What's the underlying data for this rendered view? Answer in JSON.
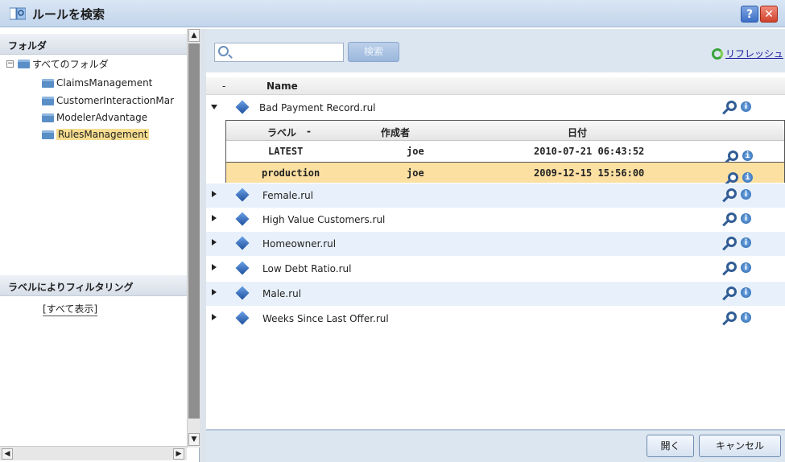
{
  "window": {
    "title": "ルールを検索",
    "help_label": "?",
    "close_label": "✕"
  },
  "left": {
    "folder_header": "フォルダ",
    "root_label": "すべてのフォルダ",
    "folders": [
      "ClaimsManagement",
      "CustomerInteractionMar",
      "ModelerAdvantage",
      "RulesManagement"
    ],
    "selected_folder": "RulesManagement",
    "filter_header": "ラベルによりフィルタリング",
    "filter_link": "[すべて表示]"
  },
  "search": {
    "placeholder": "",
    "button_label": "検索",
    "refresh_label": "リフレッシュ"
  },
  "list": {
    "col_dash": "-",
    "col_name": "Name",
    "rules": [
      "Bad Payment Record.rul",
      "Female.rul",
      "High Value Customers.rul",
      "Homeowner.rul",
      "Low Debt Ratio.rul",
      "Male.rul",
      "Weeks Since Last Offer.rul"
    ],
    "versions_header": {
      "label": "ラベル",
      "sort": "-",
      "author": "作成者",
      "date": "日付"
    },
    "versions": [
      {
        "label": "LATEST",
        "author": "joe",
        "date": "2010-07-21 06:43:52"
      },
      {
        "label": "production",
        "author": "joe",
        "date": "2009-12-15 15:56:00"
      }
    ]
  },
  "footer": {
    "open_label": "開く",
    "cancel_label": "キャンセル"
  },
  "colors": {
    "selection": "#f6dd8f",
    "accent": "#315d95",
    "panel": "#dce6f1"
  }
}
